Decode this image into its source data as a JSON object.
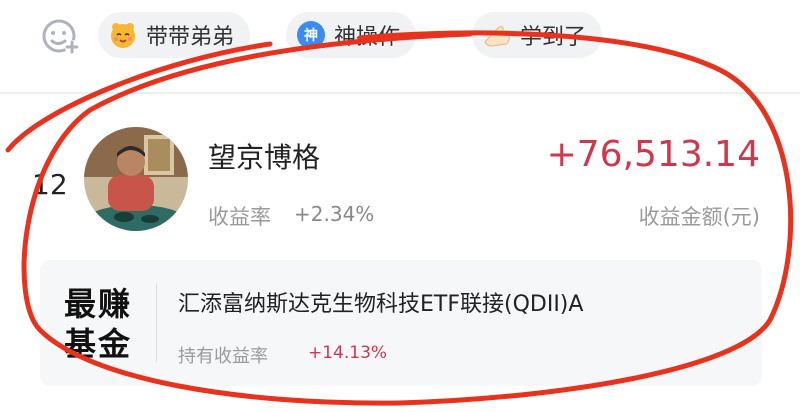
{
  "reactions": {
    "items": [
      {
        "label": "带带弟弟",
        "icon": "cute-face-icon"
      },
      {
        "label": "神操作",
        "icon": "shen-badge-icon"
      },
      {
        "label": "学到了",
        "icon": "thumbs-up-icon"
      }
    ],
    "shen_icon_char": "神"
  },
  "entry": {
    "rank": "12",
    "name": "望京博格",
    "return_label": "收益率",
    "return_value": "+2.34%",
    "amount": "+76,513.14",
    "amount_label": "收益金额(元)"
  },
  "best_fund": {
    "badge_line1": "最赚",
    "badge_line2": "基金",
    "name": "汇添富纳斯达克生物科技ETF联接(QDII)A",
    "return_label": "持有收益率",
    "return_value": "+14.13%"
  },
  "colors": {
    "accent_red": "#d0364c",
    "annotation_red": "#e8321e"
  }
}
